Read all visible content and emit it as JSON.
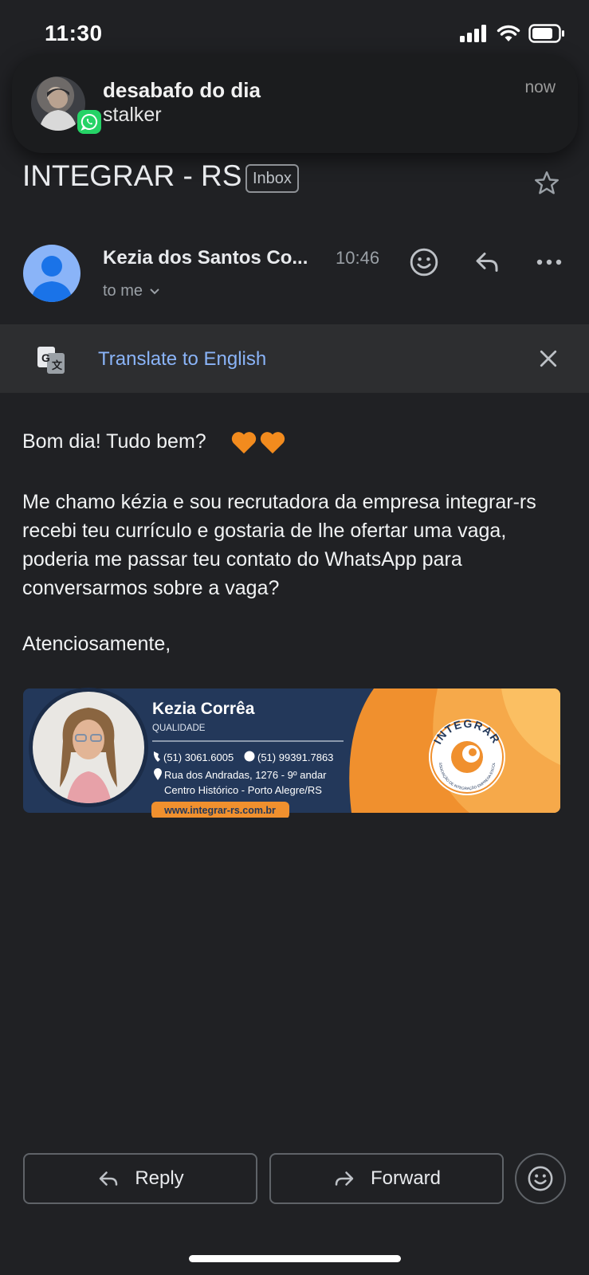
{
  "status_bar": {
    "time": "11:30"
  },
  "notification": {
    "title": "desabafo do dia",
    "body": "stalker",
    "time": "now",
    "app_icon": "whatsapp-icon"
  },
  "email": {
    "subject": "INTEGRAR - RS",
    "label": "Inbox",
    "sender_name": "Kezia dos Santos Co...",
    "time": "10:46",
    "recipient": "to me",
    "translate_link": "Translate to English",
    "greeting": "Bom dia! Tudo bem?",
    "paragraph": "Me chamo kézia e sou recrutadora da empresa integrar-rs recebi teu currículo e gostaria de lhe ofertar uma vaga, poderia me passar teu contato do WhatsApp para conversarmos sobre a vaga?",
    "closing": "Atenciosamente,"
  },
  "signature": {
    "name": "Kezia Corrêa",
    "role": "QUALIDADE",
    "phone": "(51) 3061.6005",
    "whatsapp": "(51) 99391.7863",
    "address_line1": "Rua dos Andradas, 1276 - 9º andar",
    "address_line2": "Centro Histórico - Porto Alegre/RS",
    "website": "www.integrar-rs.com.br",
    "logo_text": "INTEGRAR",
    "logo_subtext": "ASSOCIAÇÃO DE INTEGRAÇÃO EMPRESA-ESCOLA"
  },
  "actions": {
    "reply": "Reply",
    "forward": "Forward"
  },
  "colors": {
    "background": "#202124",
    "link": "#8ab4f8",
    "translate_bar": "#2d2e30",
    "signature_navy": "#1e3352",
    "signature_orange": "#f0902e"
  }
}
